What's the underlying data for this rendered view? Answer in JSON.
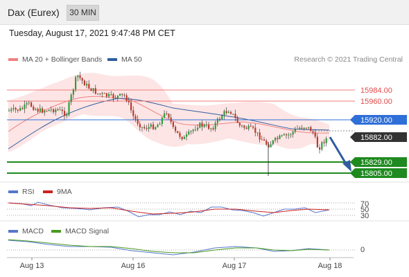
{
  "header": {
    "title": "Dax (Eurex)",
    "timeframe": "30 MIN"
  },
  "timestamp": "Tuesday, August 17, 2021 9:47:48 PM CET",
  "legend": {
    "ma20": {
      "label": "MA 20 + Bollinger Bands",
      "color": "#f08080"
    },
    "ma50": {
      "label": "MA 50",
      "color": "#2f5d9e"
    }
  },
  "credit": "Research © 2021 Trading Central",
  "price_levels": [
    {
      "value": "15984.00",
      "color": "#f07a7a",
      "style": "line"
    },
    {
      "value": "15960.00",
      "color": "#f07a7a",
      "style": "line"
    },
    {
      "value": "15920.00",
      "color": "#2f6fd8",
      "style": "box"
    },
    {
      "value": "15882.00",
      "color": "#333333",
      "style": "box"
    },
    {
      "value": "15829.00",
      "color": "#1f8a1f",
      "style": "box"
    },
    {
      "value": "15805.00",
      "color": "#1f8a1f",
      "style": "box"
    }
  ],
  "rsi": {
    "label": "RSI",
    "ma_label": "9MA",
    "levels": [
      "70",
      "50",
      "30"
    ],
    "color": "#5577cc",
    "ma_color": "#cc2222"
  },
  "macd": {
    "label": "MACD",
    "signal_label": "MACD Signal",
    "zero": "0",
    "color": "#5577cc",
    "signal_color": "#4a9a20"
  },
  "xaxis": {
    "ticks": [
      "Aug 13",
      "Aug 16",
      "Aug 17",
      "Aug 18"
    ]
  }
}
